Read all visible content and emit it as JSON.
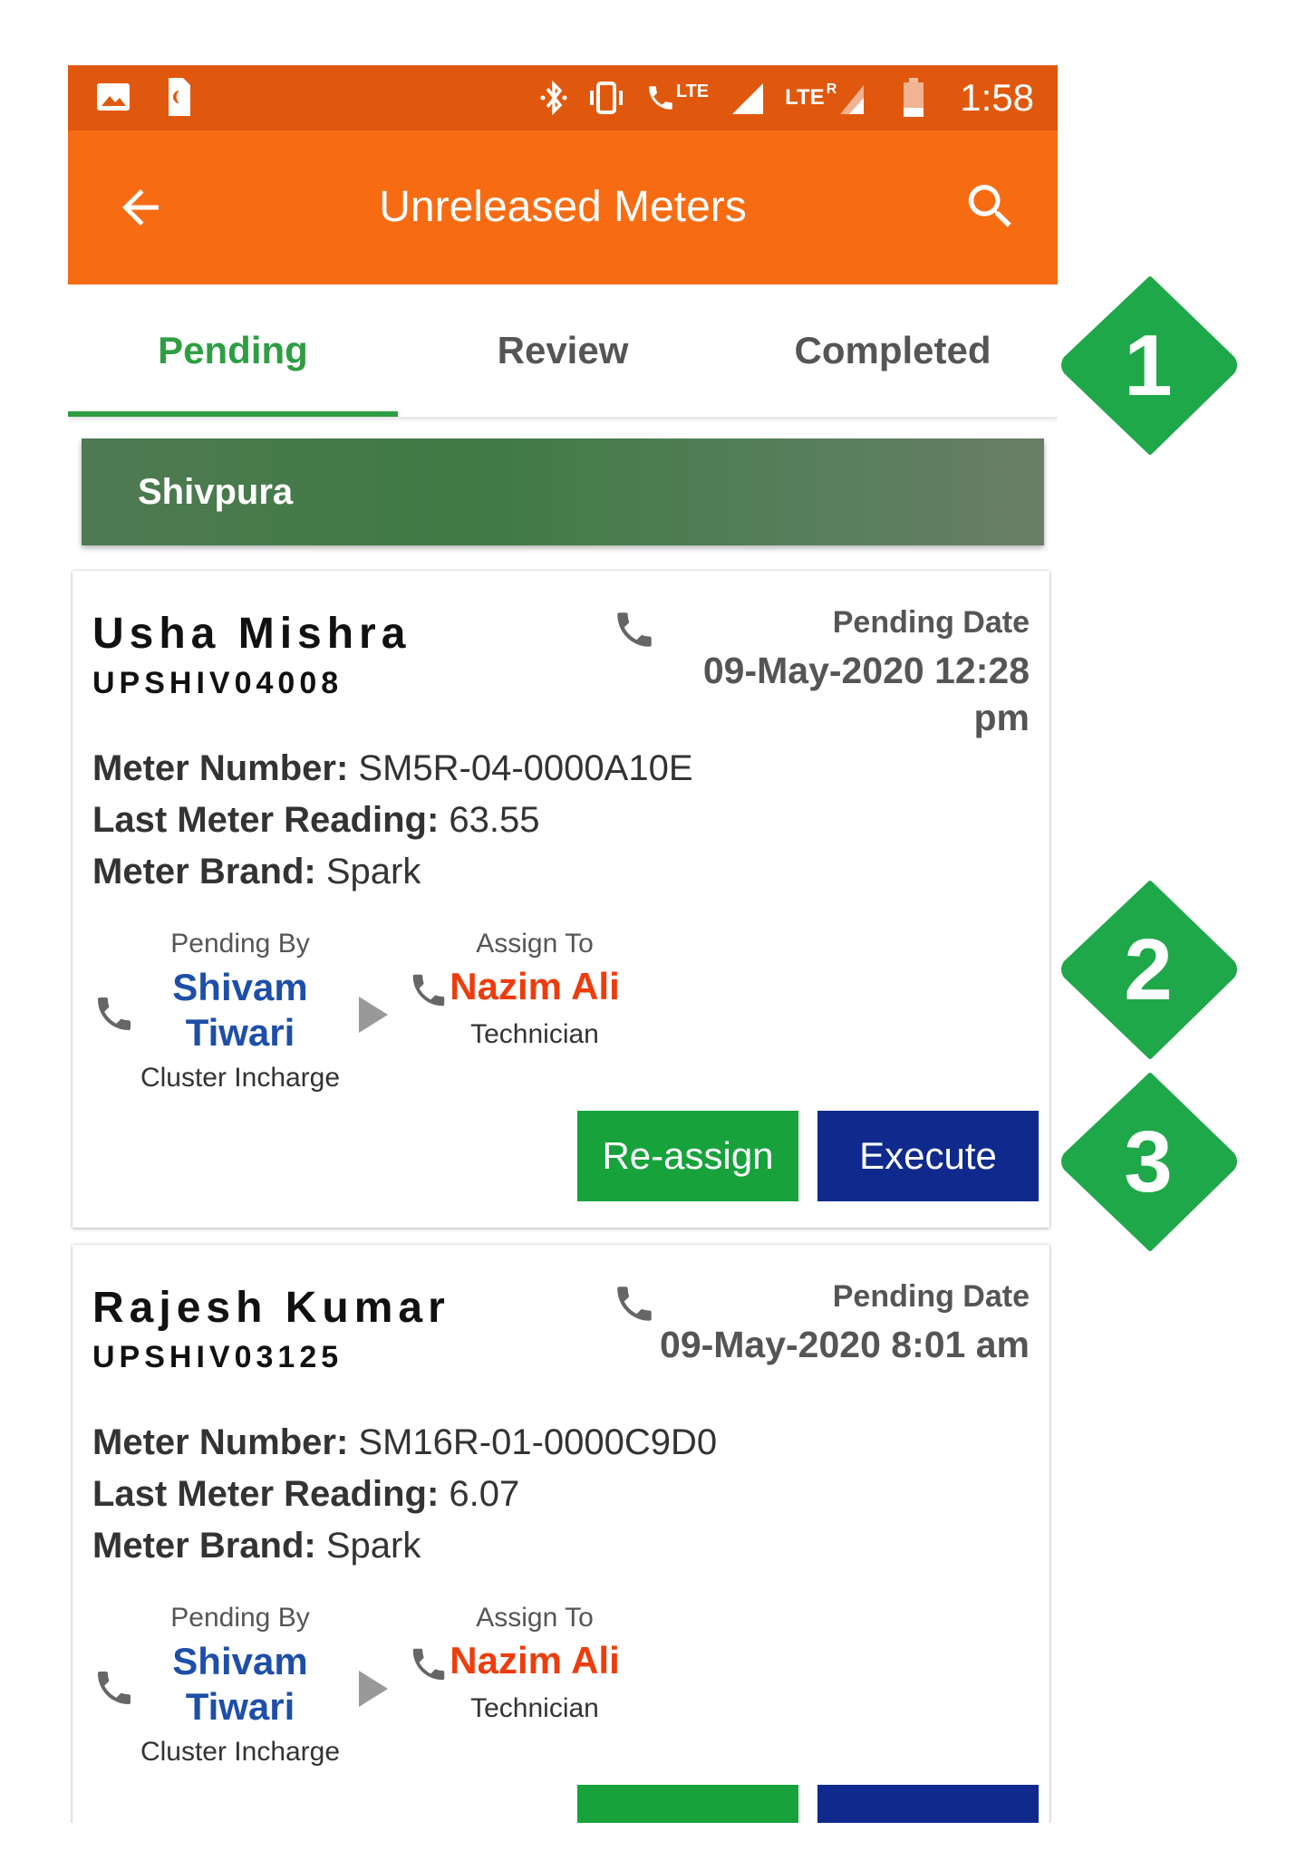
{
  "status_bar": {
    "time": "1:58",
    "network_1": "LTE",
    "network_2": "LTE",
    "roaming": "R"
  },
  "app_bar": {
    "title": "Unreleased Meters"
  },
  "tabs": [
    {
      "label": "Pending",
      "active": true
    },
    {
      "label": "Review",
      "active": false
    },
    {
      "label": "Completed",
      "active": false
    }
  ],
  "section": {
    "title": "Shivpura"
  },
  "cards": [
    {
      "name": "Usha Mishra",
      "code": "UPSHIV04008",
      "pending_date_label": "Pending Date",
      "pending_date": "09-May-2020 12:28 pm",
      "meter_number_label": "Meter Number:",
      "meter_number": "SM5R-04-0000A10E",
      "last_reading_label": "Last Meter Reading:",
      "last_reading": "63.55",
      "meter_brand_label": "Meter Brand:",
      "meter_brand": "Spark",
      "pending_by_label": "Pending By",
      "pending_by_name": "Shivam Tiwari",
      "pending_by_role": "Cluster Incharge",
      "assign_to_label": "Assign To",
      "assign_to_name": "Nazim Ali",
      "assign_to_role": "Technician",
      "reassign_label": "Re-assign",
      "execute_label": "Execute"
    },
    {
      "name": "Rajesh Kumar",
      "code": "UPSHIV03125",
      "pending_date_label": "Pending Date",
      "pending_date": "09-May-2020 8:01 am",
      "meter_number_label": "Meter Number:",
      "meter_number": "SM16R-01-0000C9D0",
      "last_reading_label": "Last Meter Reading:",
      "last_reading": "6.07",
      "meter_brand_label": "Meter Brand:",
      "meter_brand": "Spark",
      "pending_by_label": "Pending By",
      "pending_by_name": "Shivam Tiwari",
      "pending_by_role": "Cluster Incharge",
      "assign_to_label": "Assign To",
      "assign_to_name": "Nazim Ali",
      "assign_to_role": "Technician"
    }
  ],
  "callouts": [
    "1",
    "2",
    "3"
  ],
  "colors": {
    "status_bar": "#e0580d",
    "app_bar": "#f76c13",
    "tab_active": "#2e9e43",
    "pending_by_name": "#1e4fa8",
    "assign_to_name": "#ee3c0c",
    "reassign_button": "#17a23b",
    "execute_button": "#0f2a8c",
    "callout": "#1fa84a"
  }
}
